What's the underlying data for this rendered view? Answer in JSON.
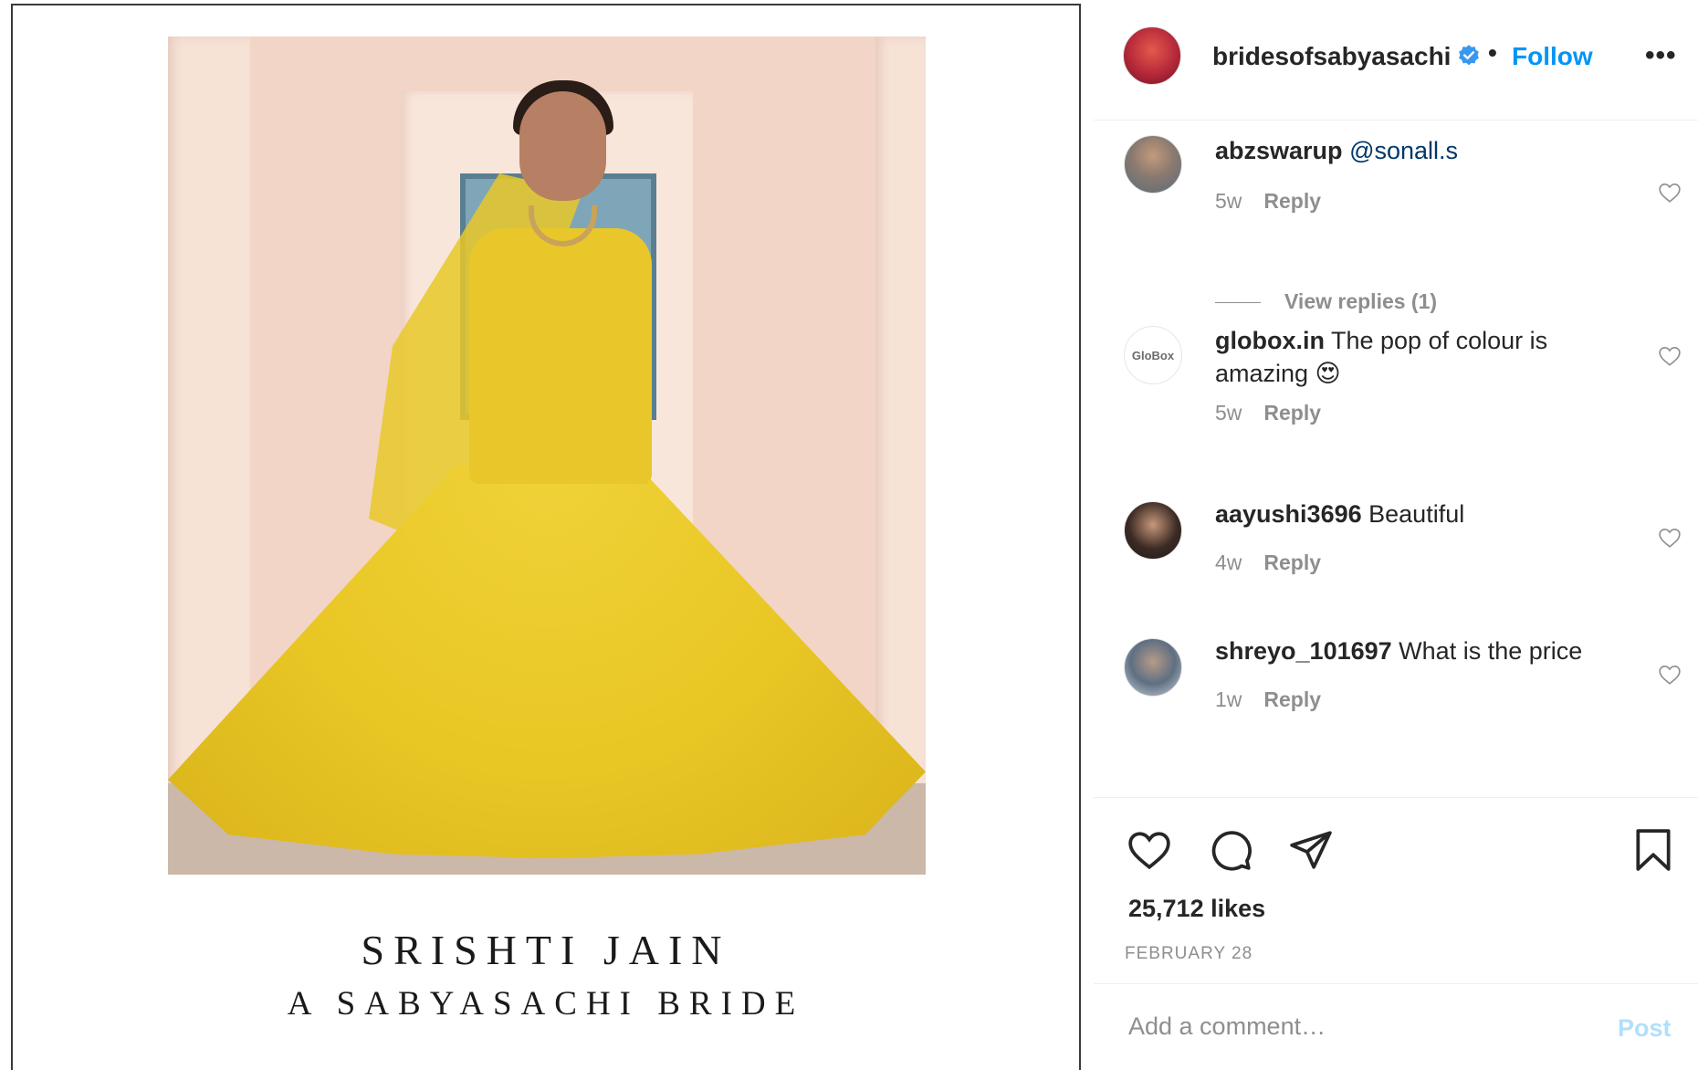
{
  "post": {
    "caption_line1": "SRISHTI JAIN",
    "caption_line2": "A SABYASACHI BRIDE"
  },
  "header": {
    "username": "bridesofsabyasachi",
    "verified_icon": "verified-badge-icon",
    "separator": "•",
    "follow_label": "Follow",
    "more_label": "•••"
  },
  "comments": [
    {
      "username": "abzswarup",
      "mention": "@sonall.s",
      "text": "",
      "age": "5w",
      "reply_label": "Reply"
    },
    {
      "username": "globox.in",
      "mention": "",
      "text": "The pop of colour is amazing 😍",
      "age": "5w",
      "reply_label": "Reply",
      "avatar_text": "GloBox"
    },
    {
      "username": "aayushi3696",
      "mention": "",
      "text": "Beautiful",
      "age": "4w",
      "reply_label": "Reply"
    },
    {
      "username": "shreyo_101697",
      "mention": "",
      "text": "What is the price",
      "age": "1w",
      "reply_label": "Reply"
    }
  ],
  "view_replies": "View replies (1)",
  "actions": {
    "like_icon": "heart-icon",
    "comment_icon": "comment-bubble-icon",
    "share_icon": "paper-plane-icon",
    "save_icon": "bookmark-icon"
  },
  "likes": "25,712 likes",
  "date": "FEBRUARY 28",
  "add_comment": {
    "placeholder": "Add a comment…",
    "post_label": "Post"
  },
  "colors": {
    "accent": "#0095f6",
    "post_disabled": "#b2dffc",
    "secondary_text": "#8e8e8e",
    "mention": "#00376b"
  }
}
